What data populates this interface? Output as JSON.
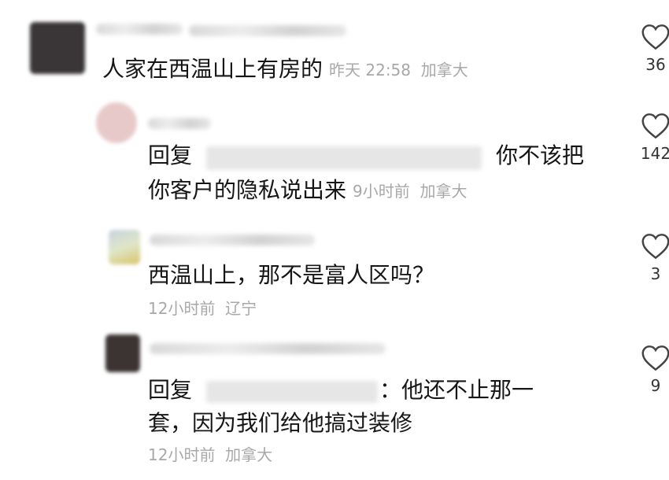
{
  "comments": [
    {
      "text": "人家在西温山上有房的",
      "time": "昨天 22:58",
      "location": "加拿大",
      "likes": "36"
    },
    {
      "reply_prefix": "回复",
      "text_line1": "你不该把",
      "text_line2": "你客户的隐私说出来",
      "time": "9小时前",
      "location": "加拿大",
      "likes": "142"
    },
    {
      "text": "西温山上，那不是富人区吗？",
      "time": "12小时前",
      "location": "辽宁",
      "likes": "3"
    },
    {
      "reply_prefix": "回复",
      "text_line1": "：他还不止那一",
      "text_line2": "套，因为我们给他搞过装修",
      "time": "12小时前",
      "location": "加拿大",
      "likes": "9"
    }
  ],
  "icons": {
    "like": "heart-outline-icon"
  }
}
